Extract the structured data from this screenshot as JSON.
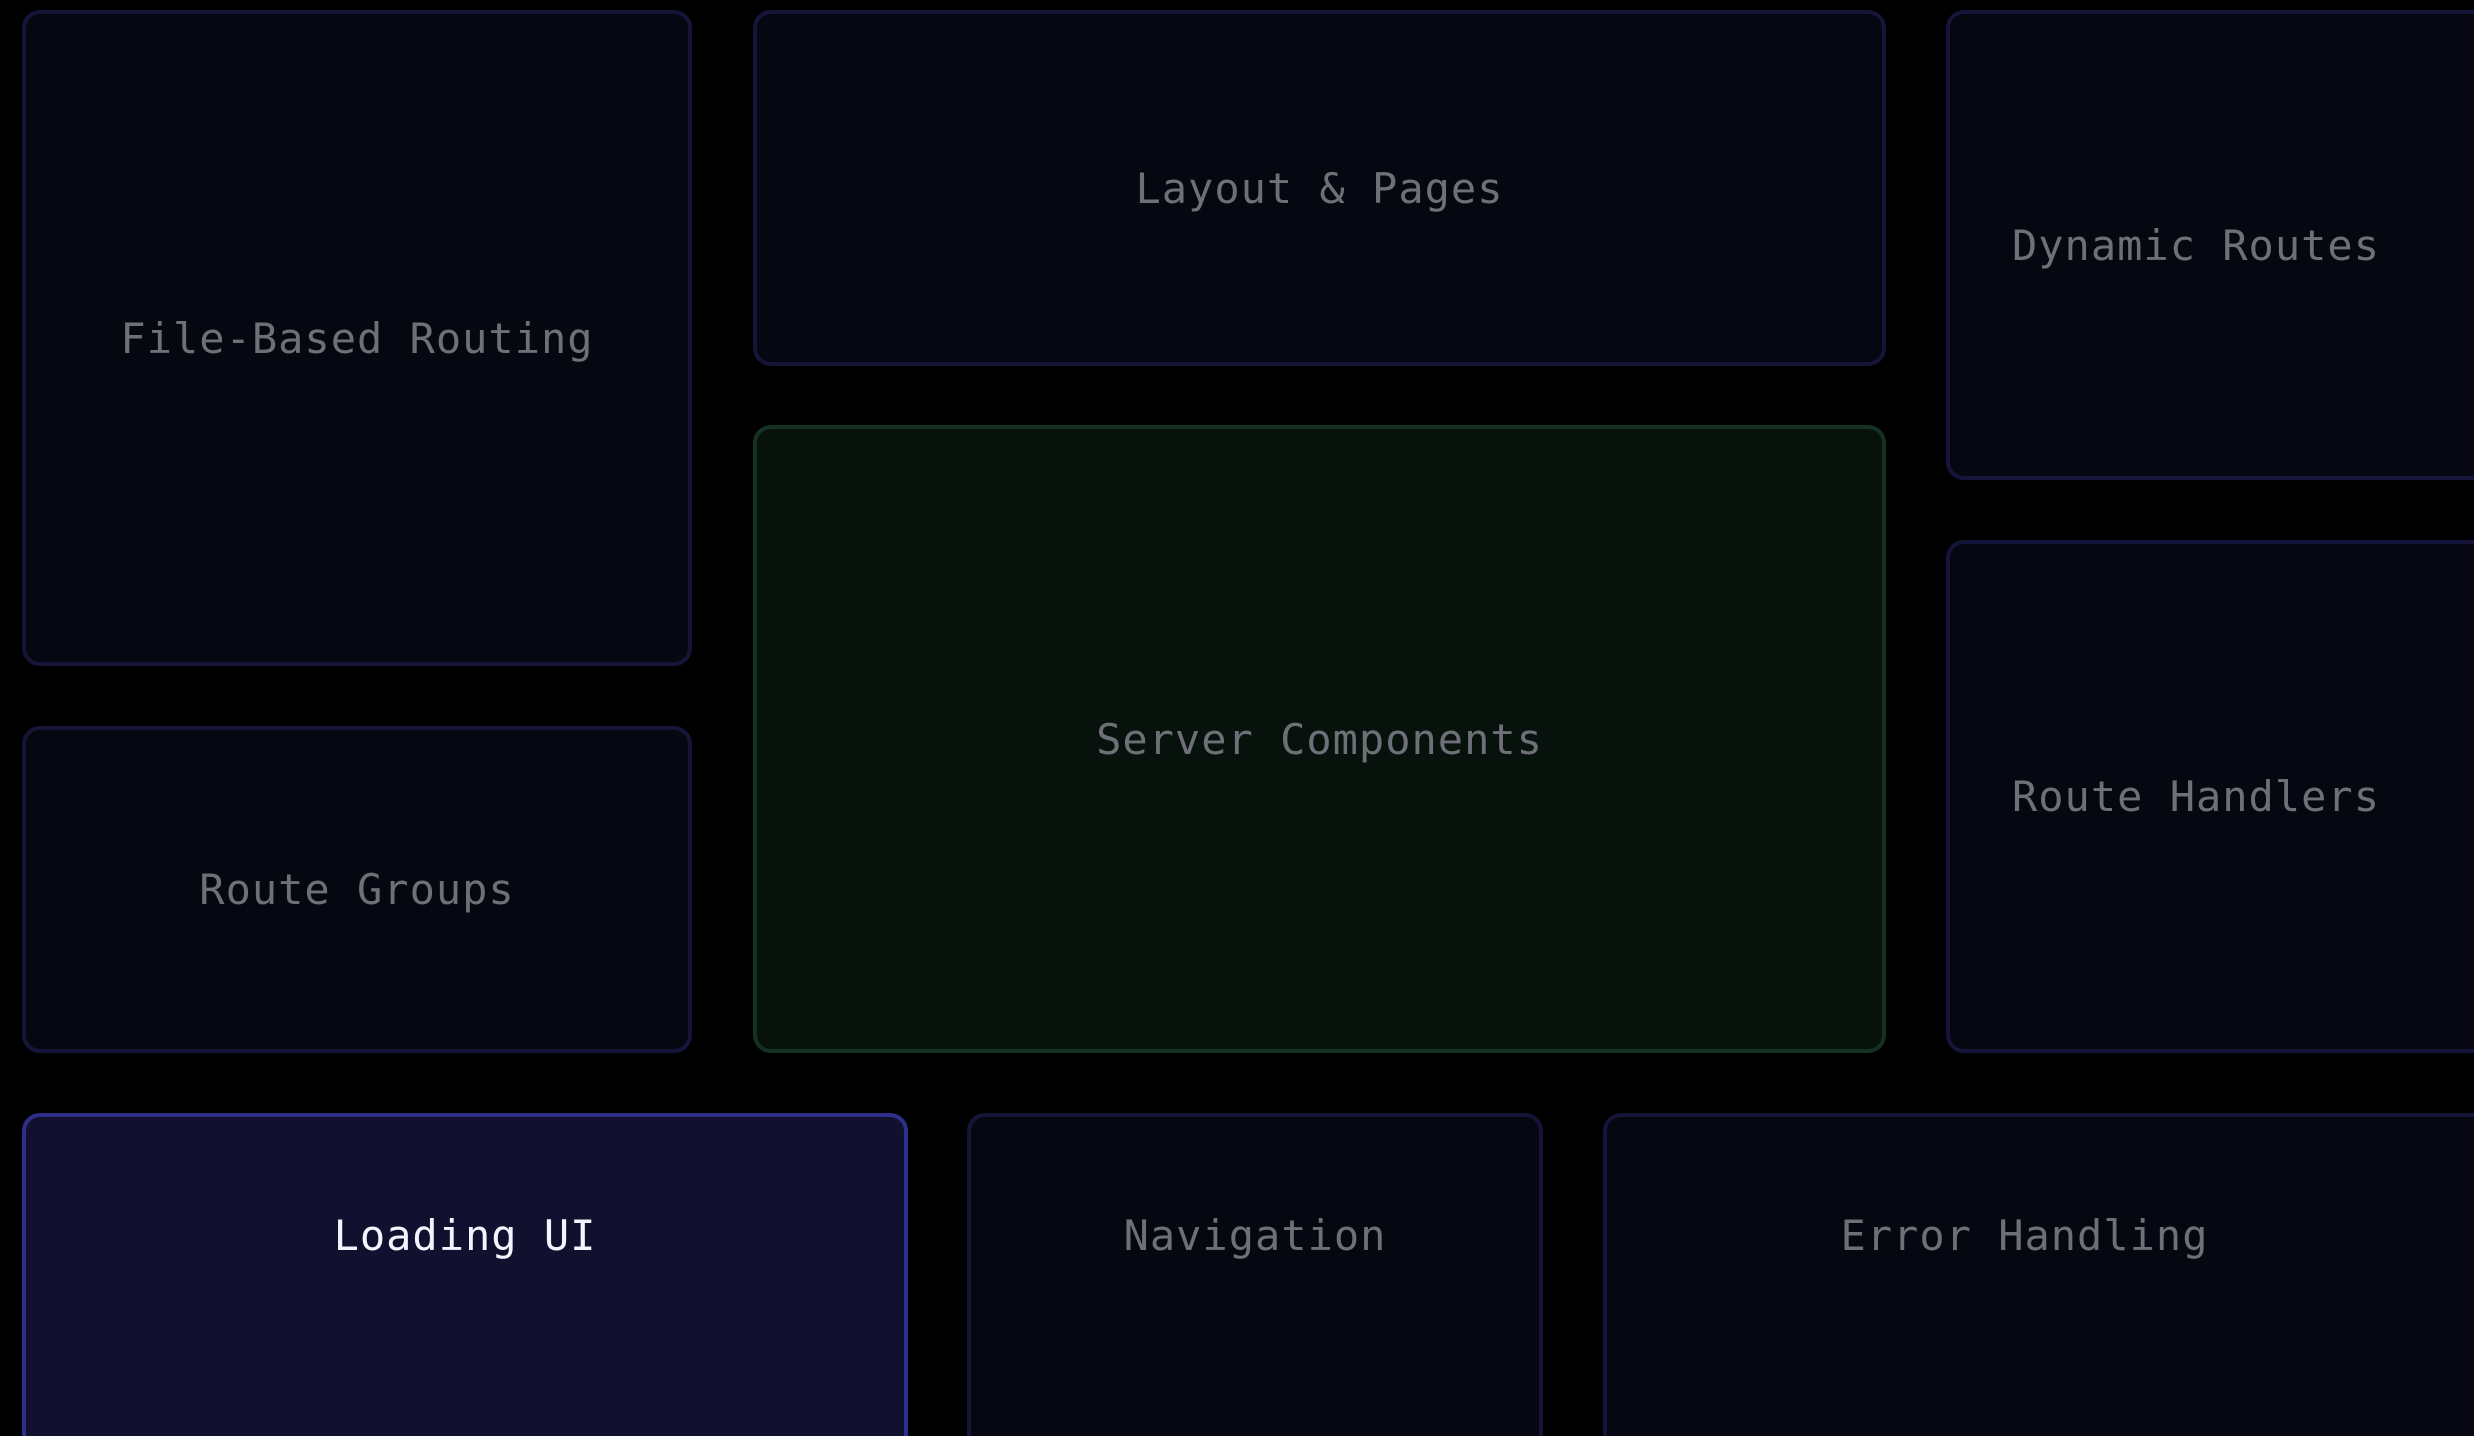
{
  "cards": {
    "file_based_routing": "File-Based Routing",
    "layout_pages": "Layout & Pages",
    "dynamic_routes": "Dynamic Routes",
    "server_components": "Server Components",
    "route_groups": "Route Groups",
    "route_handlers": "Route Handlers",
    "loading_ui": "Loading UI",
    "navigation": "Navigation",
    "error_handling": "Error Handling"
  },
  "colors": {
    "background": "#000000",
    "card_bg": "#070712",
    "card_border": "#15153a",
    "highlight_green_bg": "#08120d",
    "highlight_green_border": "#133222",
    "active_bg": "#11112f",
    "active_border": "#2d2f8a",
    "label_dim": "#6f6f78",
    "label_active": "#f4f4ff"
  },
  "active_card": "loading_ui"
}
